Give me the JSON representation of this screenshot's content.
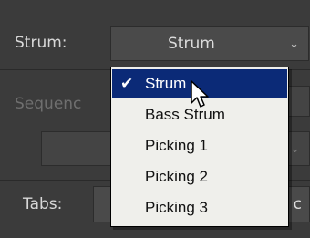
{
  "form": {
    "strum_label": "Strum:",
    "strum_value": "Strum",
    "sequence_label": "Sequenc",
    "tabs_label": "Tabs:",
    "tabs_value_fragment": "c"
  },
  "dropdown": {
    "options": [
      {
        "label": "Strum",
        "checked": true
      },
      {
        "label": "Bass Strum",
        "checked": false
      },
      {
        "label": "Picking 1",
        "checked": false
      },
      {
        "label": "Picking 2",
        "checked": false
      },
      {
        "label": "Picking 3",
        "checked": false
      }
    ],
    "check_glyph": "✔"
  },
  "icons": {
    "chevron": "chevron-down-icon",
    "cursor": "mouse-pointer-icon"
  },
  "colors": {
    "selection": "#0b2a77",
    "menu_bg": "#efefeb",
    "panel_bg": "#3b3b3b"
  }
}
